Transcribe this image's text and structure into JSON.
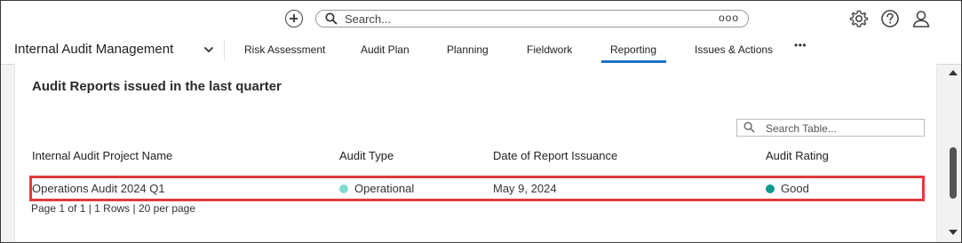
{
  "topbar": {
    "add_icon": "plus-circle-icon",
    "search_placeholder": "Search...",
    "search_more": "ooo",
    "icons": [
      "gear-icon",
      "help-icon",
      "user-icon"
    ]
  },
  "nav": {
    "app_name": "Internal Audit Management",
    "tabs": [
      {
        "label": "Risk Assessment"
      },
      {
        "label": "Audit Plan"
      },
      {
        "label": "Planning"
      },
      {
        "label": "Fieldwork"
      },
      {
        "label": "Reporting",
        "active": true
      },
      {
        "label": "Issues & Actions"
      }
    ],
    "more": "•••"
  },
  "report": {
    "title": "Audit Reports issued in the last quarter",
    "table_search_placeholder": "Search Table...",
    "columns": [
      "Internal Audit Project Name",
      "Audit Type",
      "Date of Report Issuance",
      "Audit Rating"
    ],
    "rows": [
      {
        "project": "Operations Audit 2024 Q1",
        "type": "Operational",
        "type_color": "#7fdbd3",
        "date": "May 9, 2024",
        "rating": "Good",
        "rating_color": "#11998e"
      }
    ],
    "pager": "Page 1 of 1 | 1 Rows | 20 per page"
  },
  "colors": {
    "accent": "#1a73c9",
    "highlight": "#e23b3b"
  }
}
